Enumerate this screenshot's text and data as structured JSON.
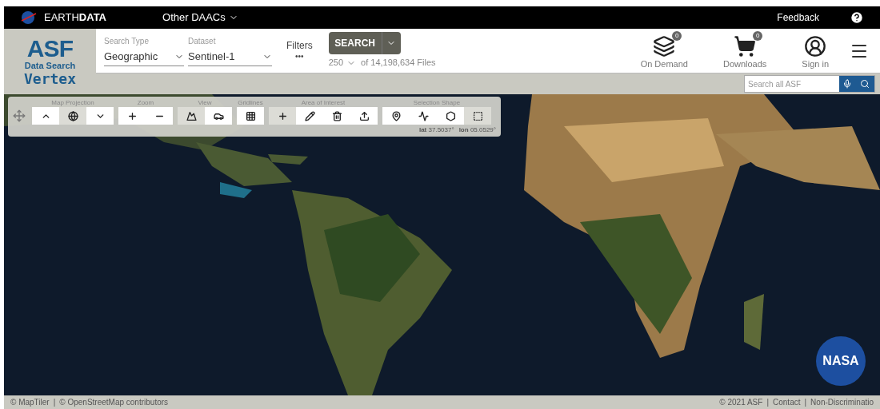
{
  "top_bar": {
    "brand": "EARTH**DATA**",
    "menu": "Other DAACs",
    "feedback": "Feedback"
  },
  "logo": {
    "mark": "ASF",
    "subtitle": "Data Search",
    "name": "Vertex"
  },
  "search_type": {
    "label": "Search Type",
    "value": "Geographic"
  },
  "dataset": {
    "label": "Dataset",
    "value": "Sentinel-1"
  },
  "filters": {
    "label": "Filters",
    "more": "•••"
  },
  "search_button": "SEARCH",
  "results": {
    "max": "250",
    "total": "of 14,198,634 Files"
  },
  "actions": [
    {
      "kind": "on_demand",
      "label": "On Demand",
      "badge": "0"
    },
    {
      "kind": "cart",
      "label": "Downloads",
      "badge": "0"
    },
    {
      "kind": "user",
      "label": "Sign in"
    }
  ],
  "site_search": {
    "placeholder": "Search all ASF"
  },
  "toolbar": {
    "groups": [
      {
        "title": "Map Projection",
        "buttons": [
          {
            "kind": "arctic",
            "selected": false
          },
          {
            "kind": "globe",
            "selected": true
          },
          {
            "kind": "antarctic",
            "selected": false
          }
        ]
      },
      {
        "title": "Zoom",
        "buttons": [
          {
            "kind": "zoom_in",
            "selected": false
          },
          {
            "kind": "zoom_out",
            "selected": false
          }
        ]
      },
      {
        "title": "View",
        "buttons": [
          {
            "kind": "terrain",
            "selected": true
          },
          {
            "kind": "car",
            "selected": false
          }
        ]
      },
      {
        "title": "Gridlines",
        "buttons": [
          {
            "kind": "grid",
            "selected": false
          }
        ]
      },
      {
        "title": "Area of Interest",
        "buttons": [
          {
            "kind": "add",
            "selected": true
          },
          {
            "kind": "pencil",
            "selected": false
          },
          {
            "kind": "trash",
            "selected": false
          },
          {
            "kind": "upload",
            "selected": false
          }
        ]
      },
      {
        "title": "Selection Shape",
        "buttons": [
          {
            "kind": "pin",
            "selected": false
          },
          {
            "kind": "line",
            "selected": false
          },
          {
            "kind": "polygon",
            "selected": false
          },
          {
            "kind": "box",
            "selected": true
          }
        ]
      }
    ],
    "lat_label": "lat",
    "lat": "37.5037°",
    "lon_label": "lon",
    "lon": "05.0529°"
  },
  "nasa_logo": "NASA",
  "footer": {
    "separator": "|",
    "left": [
      "© MapTiler",
      "© OpenStreetMap contributors"
    ],
    "right": [
      "© 2021 ASF",
      "Contact",
      "Non-Discriminatio"
    ]
  }
}
